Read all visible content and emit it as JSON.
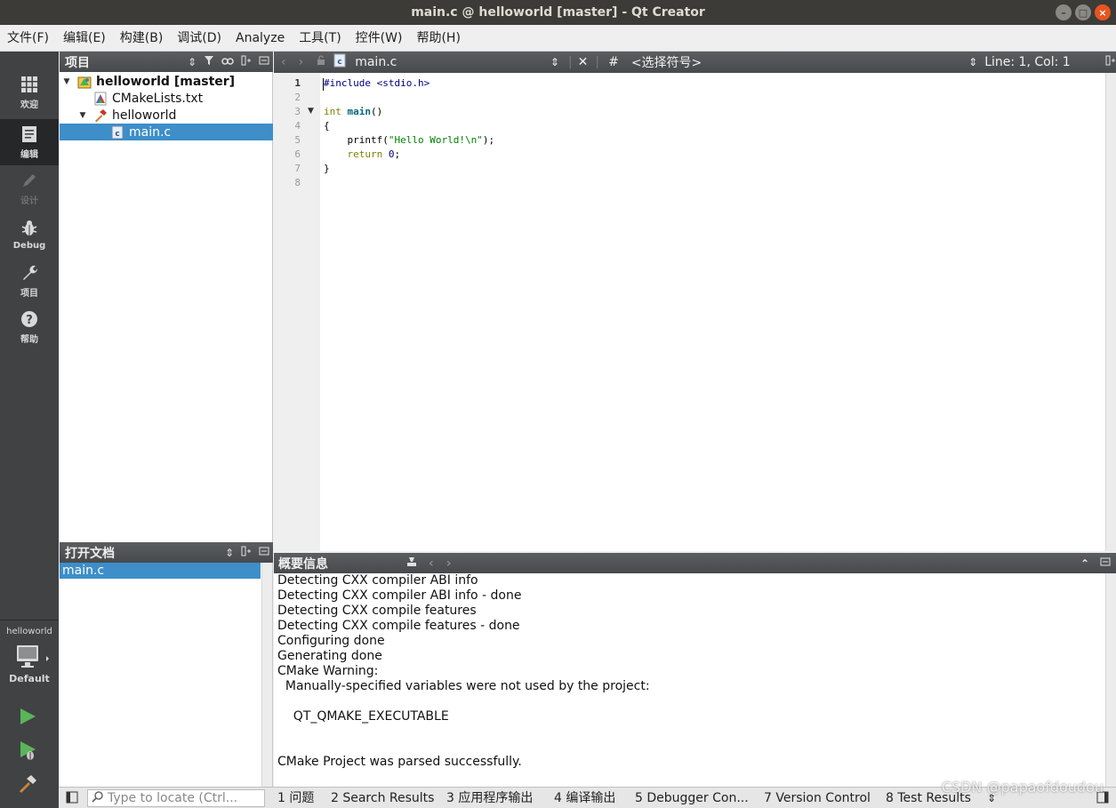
{
  "window": {
    "title": "main.c @ helloworld [master] - Qt Creator"
  },
  "menu": [
    "文件(F)",
    "编辑(E)",
    "构建(B)",
    "调试(D)",
    "Analyze",
    "工具(T)",
    "控件(W)",
    "帮助(H)"
  ],
  "modes": [
    {
      "label": "欢迎",
      "icon": "grid-icon"
    },
    {
      "label": "编辑",
      "icon": "edit-document-icon"
    },
    {
      "label": "设计",
      "icon": "pencil-icon"
    },
    {
      "label": "Debug",
      "icon": "bug-icon"
    },
    {
      "label": "项目",
      "icon": "wrench-icon"
    },
    {
      "label": "帮助",
      "icon": "help-icon"
    }
  ],
  "target": {
    "project": "helloworld",
    "config": "Default"
  },
  "project_panel": {
    "title": "项目",
    "tree": [
      {
        "label": "helloworld [master]",
        "level": 0,
        "expanded": true,
        "icon": "project-icon"
      },
      {
        "label": "CMakeLists.txt",
        "level": 1,
        "icon": "cmake-icon"
      },
      {
        "label": "helloworld",
        "level": 1,
        "expanded": true,
        "icon": "hammer-icon"
      },
      {
        "label": "main.c",
        "level": 2,
        "icon": "c-file-icon",
        "selected": true
      }
    ]
  },
  "open_docs": {
    "title": "打开文档",
    "items": [
      "main.c"
    ]
  },
  "editor": {
    "file": "main.c",
    "symbol": "<选择符号>",
    "hash": "#",
    "position": "Line: 1, Col: 1",
    "current_line": 1,
    "code": [
      "#include <stdio.h>",
      "",
      "int main()",
      "{",
      "    printf(\"Hello World!\\n\");",
      "    return 0;",
      "}",
      ""
    ]
  },
  "output": {
    "title": "概要信息",
    "lines": [
      "Detecting CXX compiler ABI info",
      "Detecting CXX compiler ABI info - done",
      "Detecting CXX compile features",
      "Detecting CXX compile features - done",
      "Configuring done",
      "Generating done",
      "CMake Warning:",
      "  Manually-specified variables were not used by the project:",
      "",
      "    QT_QMAKE_EXECUTABLE",
      "",
      "",
      "CMake Project was parsed successfully."
    ]
  },
  "statusbar": {
    "locator_placeholder": "Type to locate (Ctrl...",
    "tabs": [
      "1 问题",
      "2 Search Results",
      "3 应用程序输出",
      "4 编译输出",
      "5 Debugger Con...",
      "7 Version Control",
      "8 Test Results"
    ]
  },
  "watermark": "CSDN @papaofdoudou"
}
